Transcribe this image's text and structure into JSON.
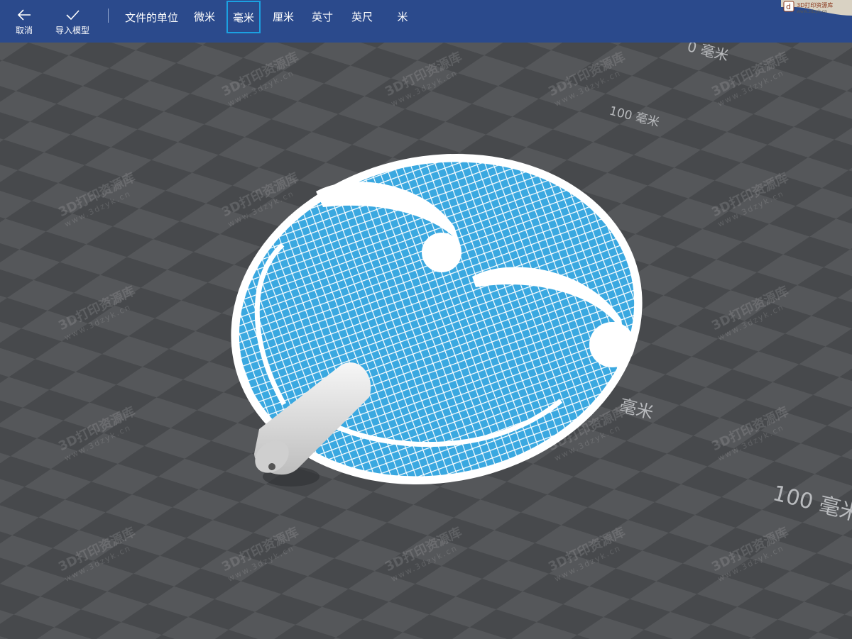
{
  "toolbar": {
    "cancel_label": "取消",
    "import_label": "导入模型",
    "units_label": "文件的单位",
    "units": [
      "微米",
      "毫米",
      "厘米",
      "英寸",
      "英尺",
      "米"
    ],
    "selected_unit": "毫米",
    "badge_text": "3D打印资源库",
    "badge_url": "www.3dzyk.cn",
    "bg_color": "#2b4a8c",
    "accent_color": "#1ba1e2"
  },
  "viewport": {
    "grid_labels": [
      "0 毫米",
      "100 毫米",
      "毫米",
      "100 毫米"
    ],
    "watermark_title": "3D打印资源库",
    "watermark_url": "www.3dzyk.cn",
    "model_color": "#3aa8e0"
  }
}
